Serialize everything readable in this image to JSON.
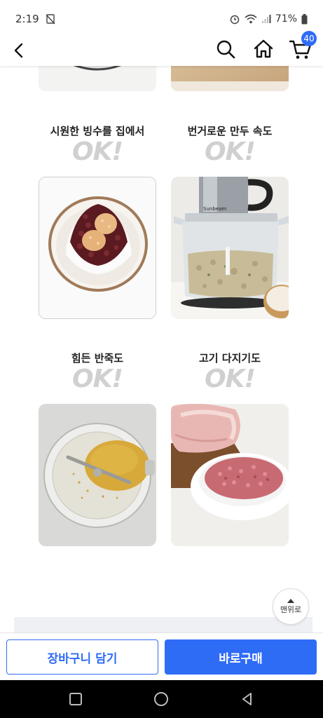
{
  "status": {
    "time": "2:19",
    "battery": "71%"
  },
  "nav": {
    "cart_count": "40"
  },
  "items": [
    {
      "caption": "시원한 빙수를 집에서",
      "ok": "OK!"
    },
    {
      "caption": "번거로운 만두 속도",
      "ok": "OK!"
    },
    {
      "caption": "힘든 반죽도",
      "ok": "OK!"
    },
    {
      "caption": "고기 다지기도",
      "ok": "OK!"
    }
  ],
  "chopper_brand": "Sunbeam",
  "scroll_top_label": "맨위로",
  "actions": {
    "add_to_cart": "장바구니 담기",
    "buy_now": "바로구매"
  },
  "colors": {
    "accent": "#2f6cf6",
    "ok_text": "#d0d0d0"
  }
}
